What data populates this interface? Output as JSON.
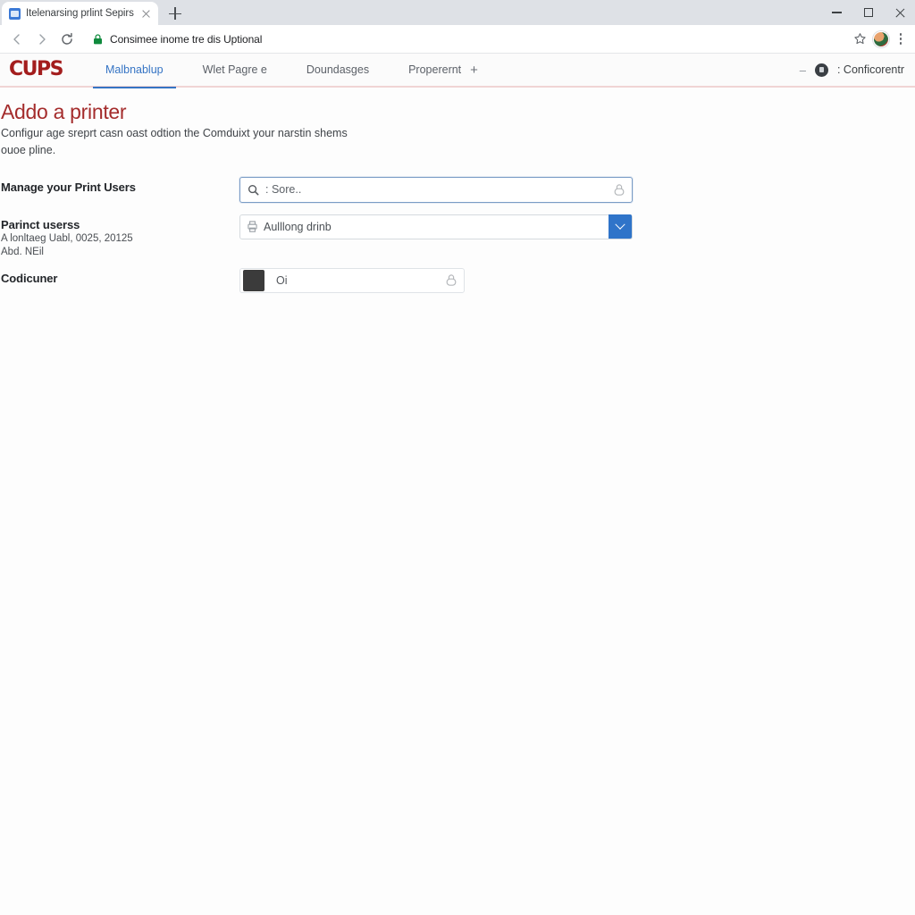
{
  "browser": {
    "tab": {
      "title": "Itelenarsing prlint Sepirs",
      "favicon_icon": "page-favicon",
      "close_icon": "close-icon"
    },
    "new_tab_icon": "plus-icon",
    "window_controls": {
      "minimize_icon": "minimize-icon",
      "maximize_icon": "maximize-icon",
      "close_icon": "close-icon"
    },
    "toolbar": {
      "back_icon": "back-arrow-icon",
      "forward_icon": "forward-arrow-icon",
      "reload_icon": "reload-icon",
      "security_icon": "lock-icon",
      "url": "Consimee inome tre dis Uptional",
      "bookmark_icon": "star-icon",
      "profile_icon": "avatar",
      "menu_icon": "kebab-menu-icon"
    }
  },
  "app": {
    "brand": "CUPS",
    "nav": [
      {
        "label": "Malbnablup",
        "active": true
      },
      {
        "label": "Wlet Pagre e",
        "active": false
      },
      {
        "label": "Doundasges",
        "active": false
      },
      {
        "label": "Properernt",
        "active": false
      }
    ],
    "nav_add_icon": "plus-icon",
    "nav_add_label": "+",
    "right": {
      "collapse_icon": "dash-icon",
      "status_icon": "printer-status-icon",
      "label": ": Conficorentr"
    }
  },
  "page": {
    "title": "Addo a printer",
    "description": "Configur age sreprt casn oast odtion the Comduixt your narstin shems ouoe pline.",
    "rows": [
      {
        "label": "Manage your Print Users",
        "sublabel": "",
        "control": {
          "type": "search",
          "left_icon": "search-icon",
          "placeholder": ": Sore..",
          "right_icon": "lock-icon"
        }
      },
      {
        "label": "Parinct userss",
        "sublabel": "A lonltaeg Uabl, 0025, 20125\nAbd. NEil",
        "control": {
          "type": "select",
          "left_icon": "printer-icon",
          "value": "Aulllong drinb",
          "dropdown_icon": "chevron-down-icon"
        }
      },
      {
        "label": "Codicuner",
        "sublabel": "",
        "control": {
          "type": "color",
          "swatch_color": "#3b3b3b",
          "value": "Oi",
          "right_icon": "lock-icon"
        }
      }
    ]
  },
  "colors": {
    "brand_red": "#a31d1d",
    "title_red": "#a42c2c",
    "accent_blue": "#3574c4",
    "dropdown_blue": "#2f74c9",
    "swatch": "#3b3b3b"
  }
}
